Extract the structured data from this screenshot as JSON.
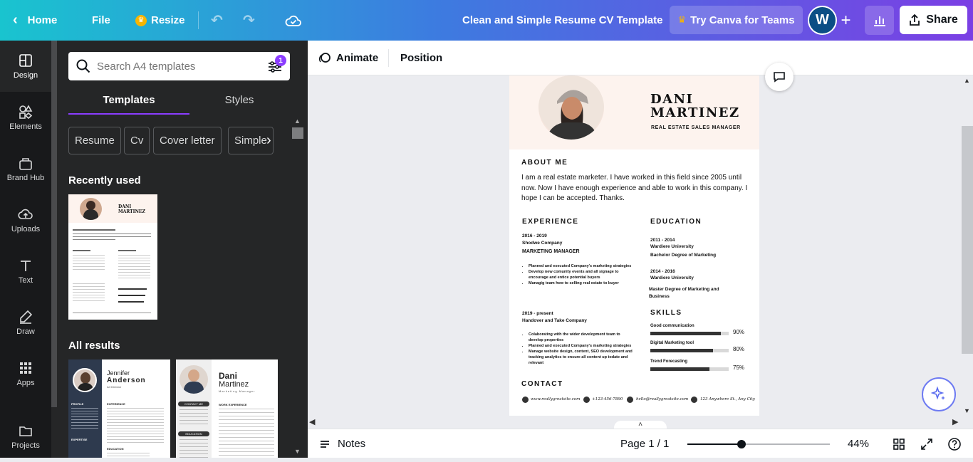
{
  "topbar": {
    "home": "Home",
    "file": "File",
    "resize": "Resize",
    "doc_title": "Clean and Simple Resume CV Template",
    "try_teams": "Try Canva for Teams",
    "avatar_letter": "W",
    "share": "Share"
  },
  "rail": {
    "items": [
      "Design",
      "Elements",
      "Brand Hub",
      "Uploads",
      "Text",
      "Draw",
      "Apps",
      "Projects"
    ]
  },
  "panel": {
    "search_placeholder": "Search A4 templates",
    "filter_badge": "1",
    "tabs": [
      "Templates",
      "Styles"
    ],
    "chips": [
      "Resume",
      "Cv",
      "Cover letter",
      "Simple"
    ],
    "recently_used": "Recently used",
    "all_results": "All results",
    "thumb2": {
      "first": "Jennifer",
      "last": "Anderson",
      "role": "Art Director",
      "s1": "PROFILE",
      "s2": "EXPERTISE",
      "s3": "EXPERIENCE",
      "s4": "EDUCATION"
    },
    "thumb3": {
      "first": "Dani",
      "last": "Martinez",
      "role": "Marketing Manager",
      "s1": "CONTACT ME",
      "s2": "EDUCATION",
      "s3": "WORK EXPERIENCE"
    }
  },
  "toolbar": {
    "animate": "Animate",
    "position": "Position"
  },
  "resume": {
    "first_name": "DANI",
    "last_name": "MARTINEZ",
    "role": "REAL ESTATE SALES MANAGER",
    "about_title": "ABOUT ME",
    "about_text": "I am a real estate marketer. I have worked in this field since 2005 until now. Now I have enough experience and able to work in this company. I hope I can be accepted. Thanks.",
    "exp_title": "EXPERIENCE",
    "exp1_dates": "2016 - 2019",
    "exp1_company": "Shodwe Company",
    "exp1_role": "MARKETING MANAGER",
    "exp1_bullets": [
      "Planned and executed Company's marketing strategies",
      "Develop new comunity events and all signage to encourage and entice potential buyers",
      "Managig team how to selling real estate to buyer"
    ],
    "exp2_dates": "2019 - present",
    "exp2_company": "Handover and Take Company",
    "exp2_bullets": [
      "Colaborating with the wider development team to develop properties",
      "Planned and executed Company's marketing strategies",
      "Manage website design, content, SEO development and tracking analytics to ensure all content up todate and relevant"
    ],
    "edu_title": "EDUCATION",
    "edu1_dates": "2011 - 2014",
    "edu1_school": "Wardiere University",
    "edu1_degree": "Bachelor Degree of Marketing",
    "edu2_dates": "2014 - 2016",
    "edu2_school": "Wardiere University",
    "edu2_degree": "Master Degree of Marketing and Business",
    "skills_title": "SKILLS",
    "skills": [
      {
        "name": "Good communication",
        "pct": "90%",
        "level": 0.9
      },
      {
        "name": "Digital Marketing tool",
        "pct": "80%",
        "level": 0.8
      },
      {
        "name": "Trend Forecasting",
        "pct": "75%",
        "level": 0.75
      }
    ],
    "contact_title": "CONTACT",
    "contact": [
      "www.reallygreatsite.com",
      "+123-456-7890",
      "hello@reallygreatsite.com",
      "123 Anywhere St., Any City"
    ]
  },
  "bottombar": {
    "notes": "Notes",
    "page": "Page 1 / 1",
    "zoom": "44%"
  },
  "colors": {
    "accent": "#8b3dff",
    "header_peach": "#fdf3ee"
  }
}
